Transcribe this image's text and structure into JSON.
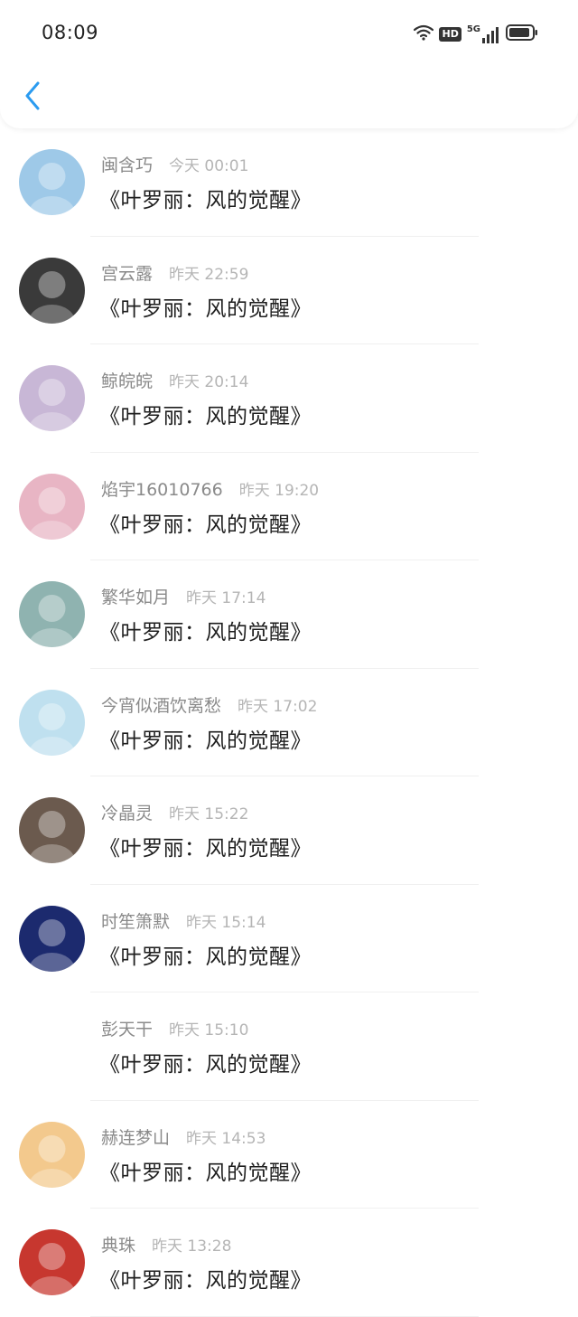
{
  "status_bar": {
    "time": "08:09",
    "hd_label": "HD",
    "network_label": "5G",
    "icons": [
      "wifi-icon",
      "hd-icon",
      "signal-5g-icon",
      "battery-icon"
    ]
  },
  "header": {
    "back_icon": "chevron-left-icon",
    "accent_color": "#2b9bf0"
  },
  "messages": [
    {
      "name": "闽含巧",
      "time": "今天 00:01",
      "text": "《叶罗丽：风的觉醒》",
      "avatar": "anime-couple-avatar",
      "bg": "#9ec9e8"
    },
    {
      "name": "宫云露",
      "time": "昨天 22:59",
      "text": "《叶罗丽：风的觉醒》",
      "avatar": "bw-portrait-avatar",
      "bg": "#3a3a3a"
    },
    {
      "name": "鲸皖皖",
      "time": "昨天 20:14",
      "text": "《叶罗丽：风的觉醒》",
      "avatar": "anime-girl-avatar",
      "bg": "#c8b7d6"
    },
    {
      "name": "焰宇16010766",
      "time": "昨天 19:20",
      "text": "《叶罗丽：风的觉醒》",
      "avatar": "anime-flowers-avatar",
      "bg": "#e8b5c4"
    },
    {
      "name": "繁华如月",
      "time": "昨天 17:14",
      "text": "《叶罗丽：风的觉醒》",
      "avatar": "anime-lady-avatar",
      "bg": "#8fb3b0"
    },
    {
      "name": "今宵似酒饮离愁",
      "time": "昨天 17:02",
      "text": "《叶罗丽：风的觉醒》",
      "avatar": "anime-idol-avatar",
      "bg": "#bfe0ef"
    },
    {
      "name": "冷晶灵",
      "time": "昨天 15:22",
      "text": "《叶罗丽：风的觉醒》",
      "avatar": "selfie-avatar",
      "bg": "#6b5a4e"
    },
    {
      "name": "时笙箫默",
      "time": "昨天 15:14",
      "text": "《叶罗丽：风的觉醒》",
      "avatar": "night-sky-avatar",
      "bg": "#1c2a6e"
    },
    {
      "name": "彭天干",
      "time": "昨天 15:10",
      "text": "《叶罗丽：风的觉醒》",
      "avatar": "panda-avatar",
      "bg": "#ffffff"
    },
    {
      "name": "赫连梦山",
      "time": "昨天 14:53",
      "text": "《叶罗丽：风的觉醒》",
      "avatar": "umbrella-girl-avatar",
      "bg": "#f3c98d"
    },
    {
      "name": "典珠",
      "time": "昨天 13:28",
      "text": "《叶罗丽：风的觉醒》",
      "avatar": "red-banner-avatar",
      "bg": "#c7372f"
    }
  ]
}
